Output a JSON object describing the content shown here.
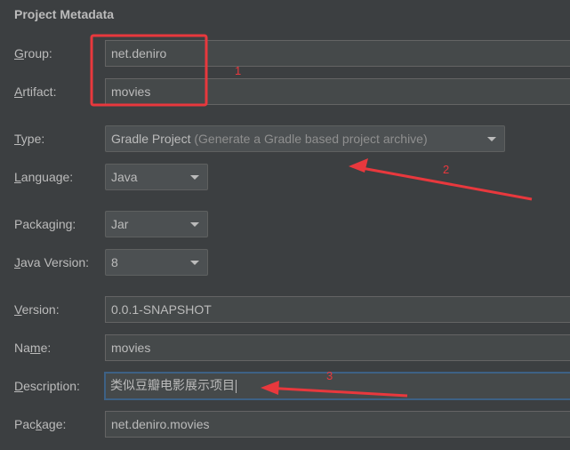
{
  "section_title": "Project Metadata",
  "fields": {
    "group": {
      "label_mnemonic": "G",
      "label_rest": "roup:",
      "value": "net.deniro"
    },
    "artifact": {
      "label_mnemonic": "A",
      "label_rest": "rtifact:",
      "value": "movies"
    },
    "type": {
      "label_mnemonic": "T",
      "label_rest": "ype:",
      "value": "Gradle Project",
      "hint": " (Generate a Gradle based project archive)"
    },
    "language": {
      "label_pre": "",
      "label_mnemonic": "L",
      "label_rest": "anguage:",
      "value": "Java"
    },
    "packaging": {
      "label_pre": "Packa",
      "label_mnemonic": "g",
      "label_rest": "ing:",
      "value": "Jar"
    },
    "java_version": {
      "label_mnemonic": "J",
      "label_rest": "ava Version:",
      "value": "8"
    },
    "version": {
      "label_mnemonic": "V",
      "label_rest": "ersion:",
      "value": "0.0.1-SNAPSHOT"
    },
    "name": {
      "label_pre": "Na",
      "label_mnemonic": "m",
      "label_rest": "e:",
      "value": "movies"
    },
    "description": {
      "label_mnemonic": "D",
      "label_rest": "escription:",
      "value": "类似豆瓣电影展示项目"
    },
    "package": {
      "label_pre": "Pac",
      "label_mnemonic": "k",
      "label_rest": "age:",
      "value": "net.deniro.movies"
    }
  },
  "annotations": {
    "color": "#e8383d",
    "labels": [
      "1",
      "2",
      "3"
    ]
  }
}
